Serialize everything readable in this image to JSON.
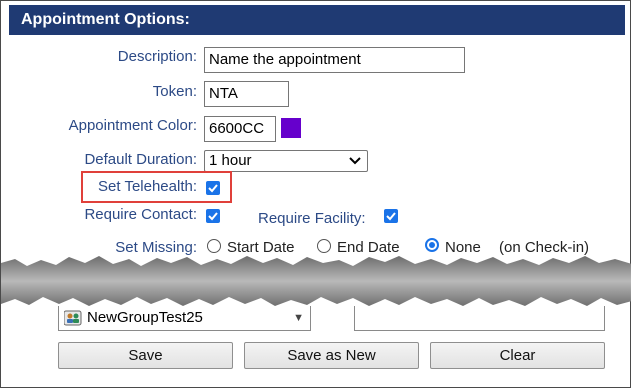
{
  "section_title": "Appointment Options:",
  "fields": {
    "description": {
      "label": "Description:",
      "value": "Name the appointment"
    },
    "token": {
      "label": "Token:",
      "value": "NTA"
    },
    "color": {
      "label": "Appointment Color:",
      "value": "6600CC",
      "swatch": "#6600cc"
    },
    "duration": {
      "label": "Default Duration:",
      "value": "1 hour"
    },
    "telehealth": {
      "label": "Set Telehealth:",
      "checked": true
    },
    "require_contact": {
      "label": "Require Contact:",
      "checked": true
    },
    "require_facility": {
      "label": "Require Facility:",
      "checked": true
    },
    "set_missing": {
      "label": "Set Missing:",
      "options": [
        "Start Date",
        "End Date",
        "None"
      ],
      "selected": "None",
      "note": "(on Check-in)"
    }
  },
  "group": {
    "value": "NewGroupTest25",
    "icon": "group-icon"
  },
  "buttons": {
    "save": "Save",
    "save_as_new": "Save as New",
    "clear": "Clear"
  },
  "colors": {
    "header": "#1f3a73",
    "label": "#2c4a86",
    "highlight": "#e0403a",
    "checkbox": "#1a73e8"
  }
}
